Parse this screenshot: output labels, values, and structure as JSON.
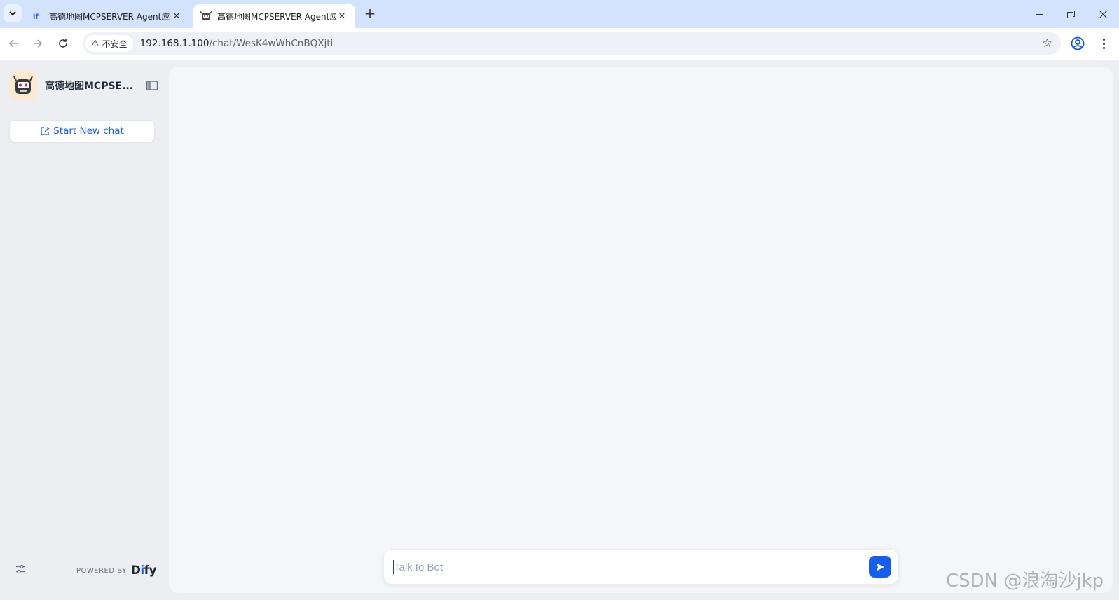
{
  "browser": {
    "tabs": [
      {
        "title": "高德地图MCPSERVER Agent应用",
        "favicon": "dify-favicon",
        "active": false
      },
      {
        "title": "高德地图MCPSERVER Agent应用",
        "favicon": "robot-favicon",
        "active": true
      }
    ],
    "security_label": "不安全",
    "url_host": "192.168.1.100",
    "url_path": "/chat/WesK4wWhCnBQXjti"
  },
  "app": {
    "name": "高德地图MCPSE...",
    "new_chat_label": "Start New chat",
    "powered_by": "POWERED BY",
    "brand_prefix": "D",
    "brand_i": "i",
    "brand_suffix": "fy",
    "accent_color": "#155eef"
  },
  "composer": {
    "placeholder": "Talk to Bot",
    "value": ""
  },
  "watermark": "CSDN @浪淘沙jkp"
}
